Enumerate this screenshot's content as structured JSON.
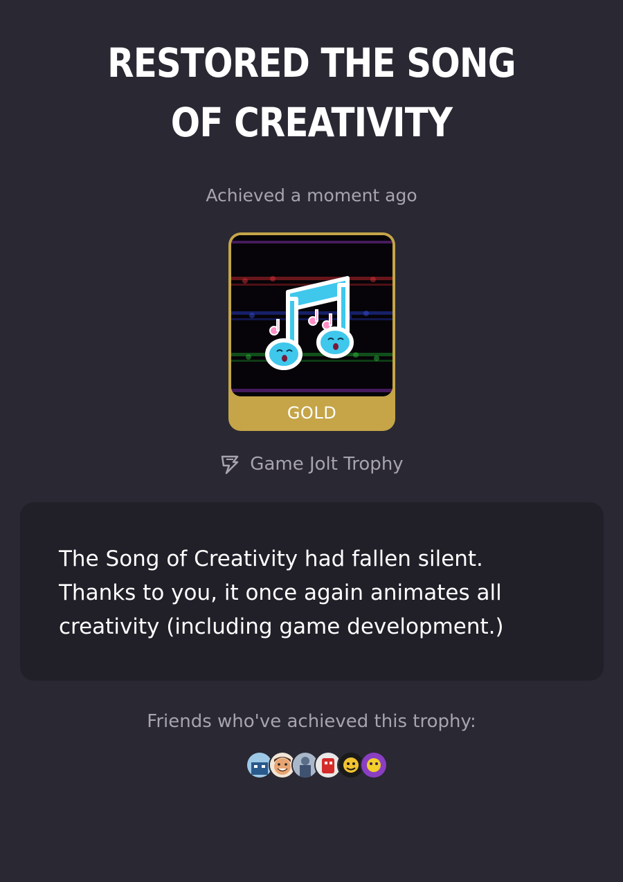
{
  "trophy": {
    "title": "Restored the Song of Creativity",
    "achieved_text": "Achieved a moment ago",
    "tier_label": "GOLD",
    "type_label": "Game Jolt Trophy",
    "description": "The Song of Creativity had fallen silent. Thanks to you, it once again animates all creativity (including game development.)",
    "icon": "music-note-trophy-icon",
    "type_icon": "game-jolt-bolt-icon"
  },
  "friends": {
    "label": "Friends who've achieved this trophy:",
    "avatars": [
      {
        "icon": "avatar-blue-character"
      },
      {
        "icon": "avatar-smiling-face"
      },
      {
        "icon": "avatar-person"
      },
      {
        "icon": "avatar-red-character"
      },
      {
        "icon": "avatar-yellow-character"
      },
      {
        "icon": "avatar-purple-character"
      }
    ]
  },
  "colors": {
    "background": "#2a2833",
    "card_background": "#211f28",
    "gold": "#c5a548",
    "muted_text": "#a7a4b0",
    "note_color": "#3fc7ec"
  }
}
